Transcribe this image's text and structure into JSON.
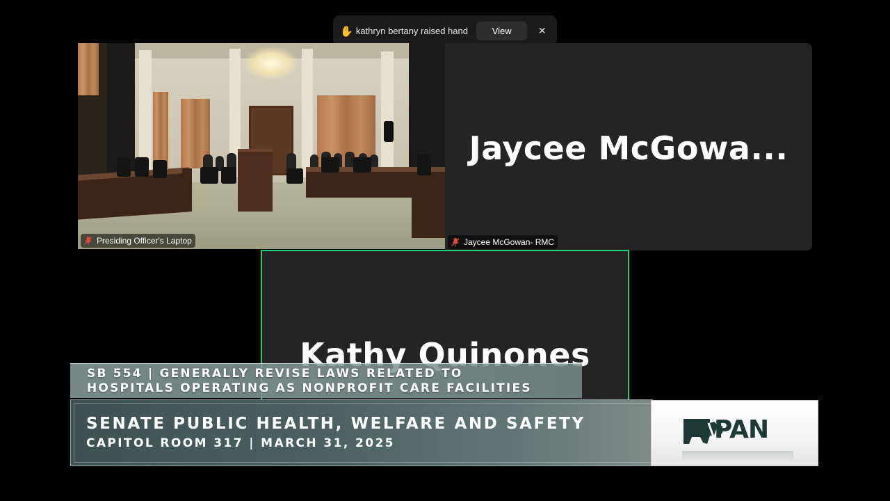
{
  "notification": {
    "message": "kathryn bertany raised hand",
    "view_label": "View",
    "close_symbol": "✕",
    "hand_icon": "raised-hand-icon"
  },
  "tiles": [
    {
      "id": "room",
      "label": "Presiding Officer's Laptop",
      "muted": true,
      "has_video": true
    },
    {
      "id": "jaycee",
      "display_name": "Jaycee  McGowa...",
      "label": "Jaycee McGowan- RMC",
      "muted": true,
      "has_video": false
    },
    {
      "id": "kathy",
      "display_name": "Kathy Quinones",
      "active_speaker": true,
      "has_video": false
    }
  ],
  "lower_third": {
    "bill_line1": "SB 554 | GENERALLY REVISE LAWS RELATED TO",
    "bill_line2": "HOSPITALS OPERATING AS NONPROFIT CARE FACILITIES",
    "committee": "SENATE PUBLIC HEALTH, WELFARE AND SAFETY",
    "location_date": "CAPITOL ROOM 317 | MARCH 31, 2025",
    "logo_text": "PAN"
  },
  "colors": {
    "active_speaker_border": "#21d07a",
    "mute_icon": "#e0483e",
    "logo_dark": "#1f3a36"
  }
}
